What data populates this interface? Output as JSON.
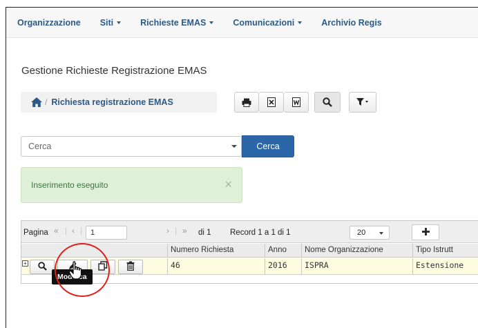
{
  "nav": {
    "items": [
      {
        "label": "Organizzazione",
        "dropdown": false
      },
      {
        "label": "Siti",
        "dropdown": true
      },
      {
        "label": "Richieste EMAS",
        "dropdown": true
      },
      {
        "label": "Comunicazioni",
        "dropdown": true
      },
      {
        "label": "Archivio Regis",
        "dropdown": false
      }
    ]
  },
  "page": {
    "title": "Gestione Richieste Registrazione EMAS"
  },
  "breadcrumb": {
    "separator": "/",
    "label": "Richiesta registrazione EMAS"
  },
  "toolbar": {
    "icons": [
      "print-icon",
      "excel-icon",
      "word-icon",
      "search-icon",
      "filter-icon"
    ]
  },
  "search": {
    "placeholder": "Cerca",
    "button_label": "Cerca"
  },
  "alert": {
    "message": "Inserimento eseguito",
    "close": "×"
  },
  "pager": {
    "page_label": "Pagina",
    "first": "«",
    "prev": "‹",
    "page_value": "1",
    "next": "›",
    "last": "»",
    "of_pages": "di 1",
    "records": "Record 1 a 1 di 1",
    "page_size": "20"
  },
  "grid": {
    "columns": [
      "Numero Richiesta",
      "Anno",
      "Nome Organizzazione",
      "Tipo Istrutt"
    ],
    "rows": [
      {
        "numero": "46",
        "anno": "2016",
        "organizzazione": "ISPRA",
        "tipo": "Estensione"
      }
    ]
  },
  "tooltip": {
    "text": "Modifica"
  },
  "colors": {
    "nav_link": "#2c5a86",
    "primary_button": "#2b66a8",
    "alert_bg": "#dff0d8",
    "selected_row": "#fdfce0",
    "highlight": "#e0201a"
  }
}
